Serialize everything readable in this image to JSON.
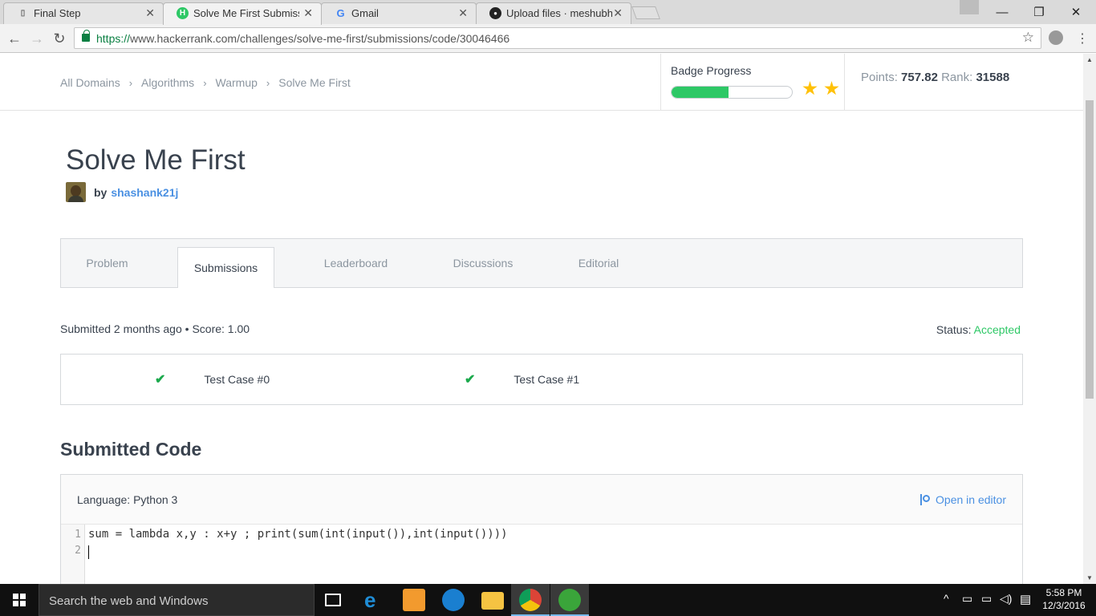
{
  "browser": {
    "tabs": [
      {
        "label": "Final Step",
        "close": "✕"
      },
      {
        "label": "Solve Me First Submissio",
        "close": "✕"
      },
      {
        "label": "Gmail",
        "close": "✕"
      },
      {
        "label": "Upload files · meshubhar",
        "close": "✕"
      }
    ],
    "url_proto": "https://",
    "url_rest": "www.hackerrank.com/challenges/solve-me-first/submissions/code/30046466",
    "window_controls": {
      "minimize": "—",
      "restore": "❐",
      "close": "✕"
    }
  },
  "breadcrumbs": [
    "All Domains",
    "Algorithms",
    "Warmup",
    "Solve Me First"
  ],
  "crumb_sep": "›",
  "badge": {
    "title": "Badge Progress",
    "progress": 0.47,
    "stars": 2
  },
  "stats": {
    "points_label": "Points:",
    "points": "757.82",
    "rank_label": "Rank:",
    "rank": "31588"
  },
  "challenge": {
    "title": "Solve Me First",
    "by": "by",
    "author": "shashank21j"
  },
  "page_tabs": [
    "Problem",
    "Submissions",
    "Leaderboard",
    "Discussions",
    "Editorial"
  ],
  "submission": {
    "meta": "Submitted 2 months ago • Score: 1.00",
    "status_label": "Status:",
    "status": "Accepted",
    "test_cases": [
      "Test Case #0",
      "Test Case #1"
    ]
  },
  "code": {
    "section_title": "Submitted Code",
    "language": "Language: Python 3",
    "open_editor": "Open in editor",
    "lines": [
      "sum = lambda x,y : x+y ; print(sum(int(input()),int(input())))",
      ""
    ],
    "line_numbers": [
      "1",
      "2"
    ]
  },
  "taskbar": {
    "search_placeholder": "Search the web and Windows",
    "time": "5:58 PM",
    "date": "12/3/2016"
  },
  "colors": {
    "accent_green": "#2ec866",
    "link_blue": "#4a90e2",
    "star": "#ffc107"
  }
}
